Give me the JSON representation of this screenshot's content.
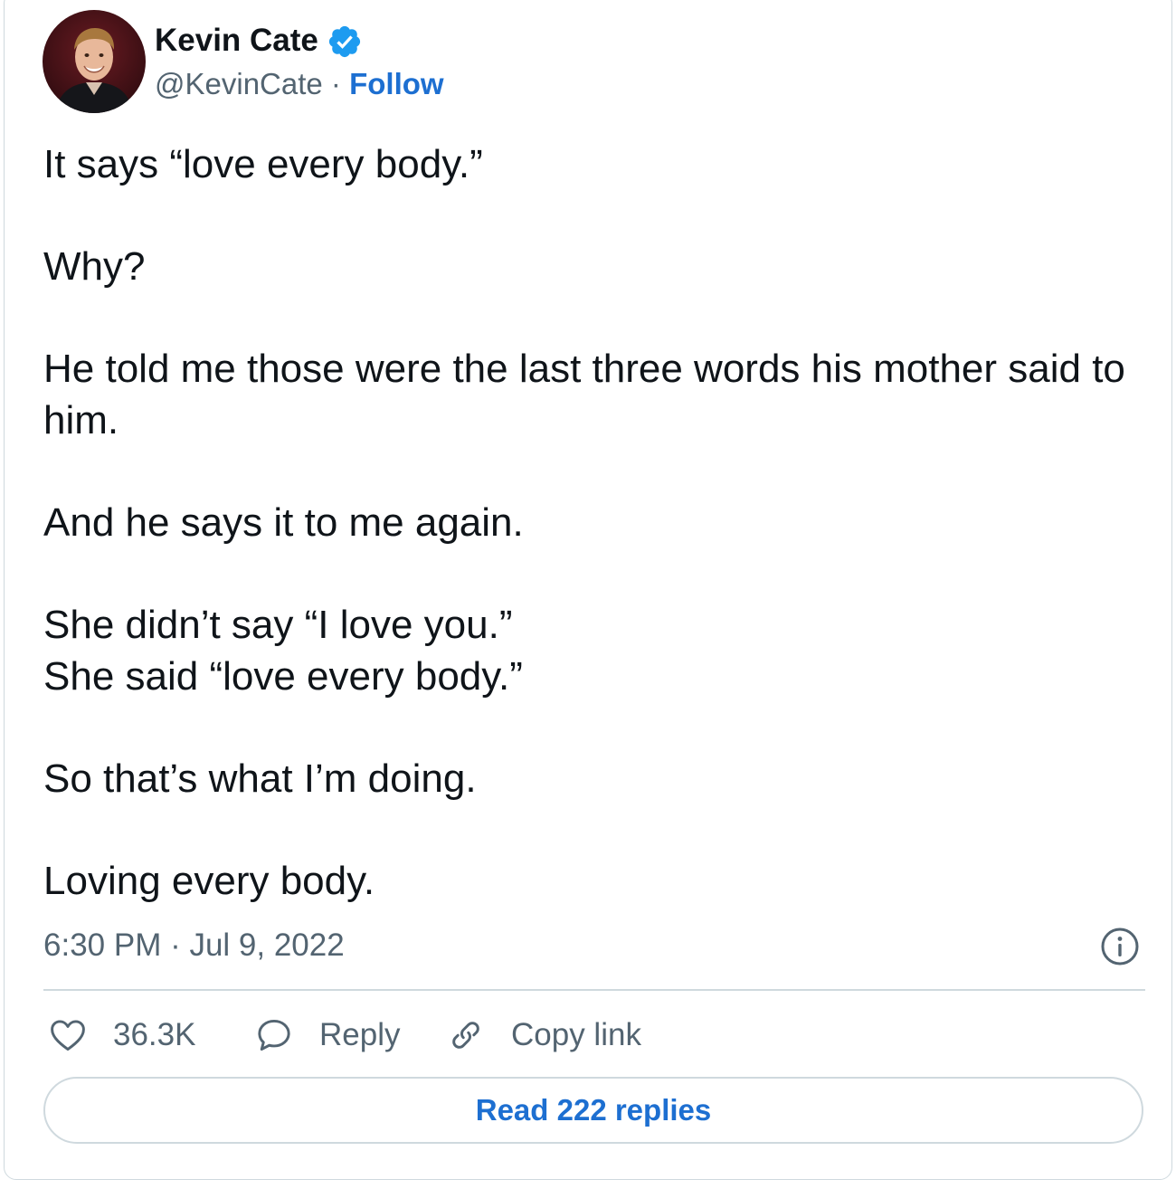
{
  "author": {
    "name": "Kevin Cate",
    "handle": "@KevinCate",
    "separator": " · ",
    "follow_label": "Follow",
    "verified": true
  },
  "tweet": {
    "paragraphs": [
      "It says “love every body.”",
      "Why?",
      "He told me those were the last three words his mother said to him.",
      "And he says it to me again.",
      "She didn’t say “I love you.”\nShe said “love every body.”",
      "So that’s what I’m doing.",
      "Loving every body."
    ],
    "timestamp": "6:30 PM · Jul 9, 2022"
  },
  "actions": {
    "like_count": "36.3K",
    "reply_label": "Reply",
    "copy_label": "Copy link"
  },
  "read_replies_label": "Read 222 replies",
  "colors": {
    "link": "#1d6fd1",
    "verified": "#1d9bf0",
    "muted_text": "#536471",
    "border": "#cfd9de"
  },
  "icons": [
    "verified-badge-icon",
    "info-icon",
    "heart-icon",
    "speech-bubble-icon",
    "link-icon"
  ]
}
